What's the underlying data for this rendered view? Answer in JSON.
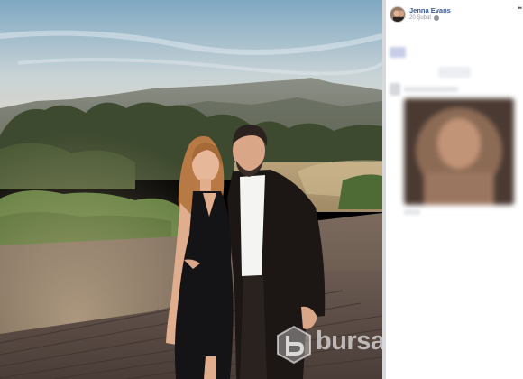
{
  "post": {
    "author": "Jenna Evans",
    "date": "20 Şubat",
    "privacy_icon": "globe-icon",
    "more_icon": "ellipsis-icon"
  },
  "watermark": {
    "text": "bursa"
  }
}
